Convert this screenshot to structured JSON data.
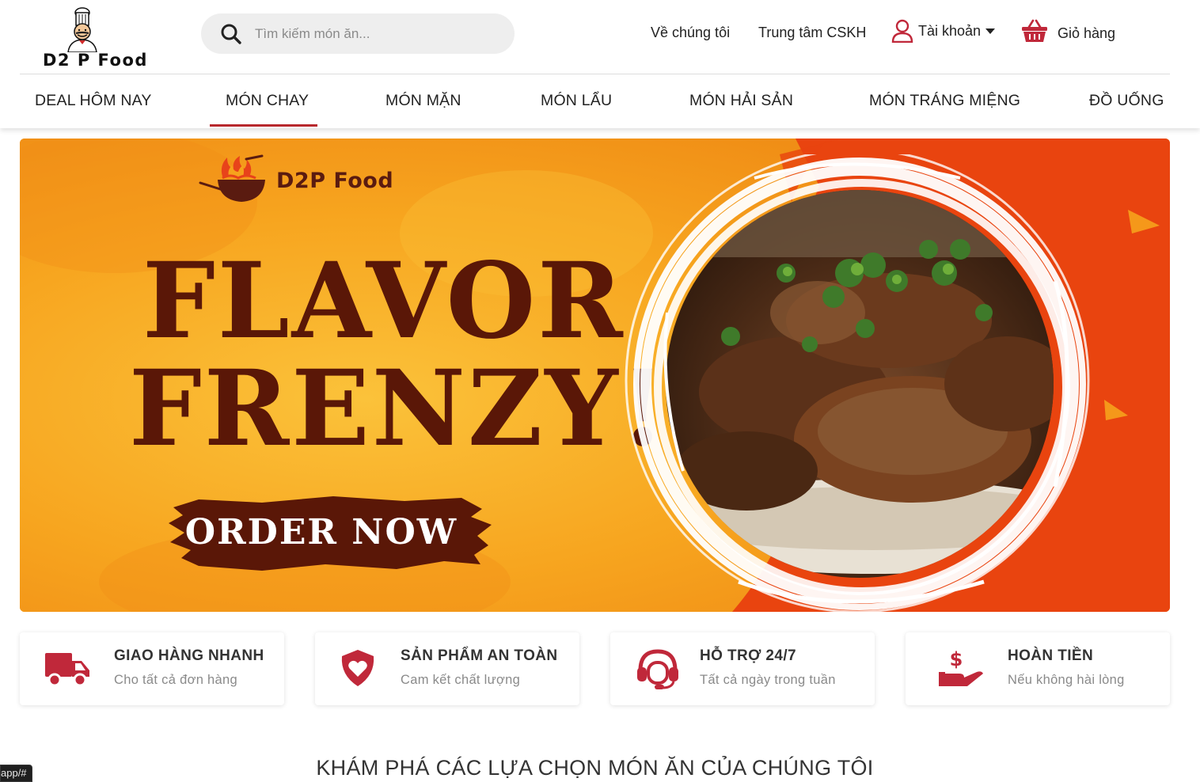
{
  "header": {
    "logo_text": "D2 P Food",
    "search": {
      "placeholder": "Tìm kiếm món ăn..."
    },
    "links": {
      "about": "Về chúng tôi",
      "support": "Trung tâm CSKH",
      "account": "Tài khoản",
      "cart": "Giỏ hàng"
    }
  },
  "nav": {
    "items": [
      "DEAL HÔM NAY",
      "MÓN CHAY",
      "MÓN MẶN",
      "MÓN LẨU",
      "MÓN HẢI SẢN",
      "MÓN TRÁNG MIỆNG",
      "ĐỒ UỐNG"
    ],
    "active": "MÓN CHAY"
  },
  "banner": {
    "brand": "D2P Food",
    "headline_1": "FLAVOR",
    "headline_2": "FRENZY!",
    "cta": "ORDER NOW"
  },
  "features": [
    {
      "title": "GIAO HÀNG NHANH",
      "subtitle": "Cho tất cả đơn hàng",
      "icon": "truck-icon"
    },
    {
      "title": "SẢN PHẨM AN TOÀN",
      "subtitle": "Cam kết chất lượng",
      "icon": "shield-heart-icon"
    },
    {
      "title": "HỖ TRỢ 24/7",
      "subtitle": "Tất cả ngày trong tuần",
      "icon": "headset-icon"
    },
    {
      "title": "HOÀN TIỀN",
      "subtitle": "Nếu không hài lòng",
      "icon": "money-hand-icon"
    }
  ],
  "section_title": "KHÁM PHÁ CÁC LỰA CHỌN MÓN ĂN CỦA CHÚNG TÔI",
  "status_bar": {
    "url": "app/#"
  },
  "colors": {
    "brand_red": "#b8282d",
    "banner_orange": "#f6a21c",
    "banner_red": "#e8420f",
    "headline_brown": "#5a1707"
  }
}
